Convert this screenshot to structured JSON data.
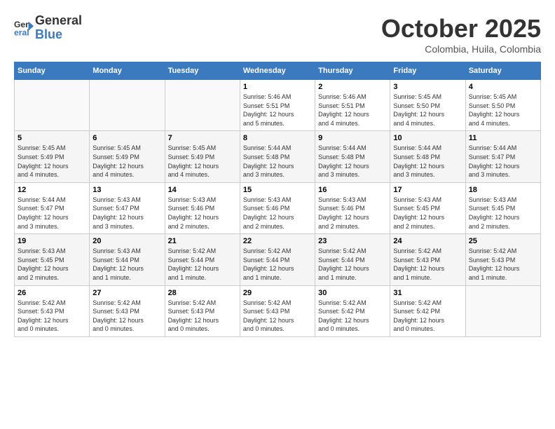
{
  "logo": {
    "line1": "General",
    "line2": "Blue"
  },
  "title": "October 2025",
  "subtitle": "Colombia, Huila, Colombia",
  "days_header": [
    "Sunday",
    "Monday",
    "Tuesday",
    "Wednesday",
    "Thursday",
    "Friday",
    "Saturday"
  ],
  "weeks": [
    [
      {
        "day": "",
        "info": ""
      },
      {
        "day": "",
        "info": ""
      },
      {
        "day": "",
        "info": ""
      },
      {
        "day": "1",
        "info": "Sunrise: 5:46 AM\nSunset: 5:51 PM\nDaylight: 12 hours\nand 5 minutes."
      },
      {
        "day": "2",
        "info": "Sunrise: 5:46 AM\nSunset: 5:51 PM\nDaylight: 12 hours\nand 4 minutes."
      },
      {
        "day": "3",
        "info": "Sunrise: 5:45 AM\nSunset: 5:50 PM\nDaylight: 12 hours\nand 4 minutes."
      },
      {
        "day": "4",
        "info": "Sunrise: 5:45 AM\nSunset: 5:50 PM\nDaylight: 12 hours\nand 4 minutes."
      }
    ],
    [
      {
        "day": "5",
        "info": "Sunrise: 5:45 AM\nSunset: 5:49 PM\nDaylight: 12 hours\nand 4 minutes."
      },
      {
        "day": "6",
        "info": "Sunrise: 5:45 AM\nSunset: 5:49 PM\nDaylight: 12 hours\nand 4 minutes."
      },
      {
        "day": "7",
        "info": "Sunrise: 5:45 AM\nSunset: 5:49 PM\nDaylight: 12 hours\nand 4 minutes."
      },
      {
        "day": "8",
        "info": "Sunrise: 5:44 AM\nSunset: 5:48 PM\nDaylight: 12 hours\nand 3 minutes."
      },
      {
        "day": "9",
        "info": "Sunrise: 5:44 AM\nSunset: 5:48 PM\nDaylight: 12 hours\nand 3 minutes."
      },
      {
        "day": "10",
        "info": "Sunrise: 5:44 AM\nSunset: 5:48 PM\nDaylight: 12 hours\nand 3 minutes."
      },
      {
        "day": "11",
        "info": "Sunrise: 5:44 AM\nSunset: 5:47 PM\nDaylight: 12 hours\nand 3 minutes."
      }
    ],
    [
      {
        "day": "12",
        "info": "Sunrise: 5:44 AM\nSunset: 5:47 PM\nDaylight: 12 hours\nand 3 minutes."
      },
      {
        "day": "13",
        "info": "Sunrise: 5:43 AM\nSunset: 5:47 PM\nDaylight: 12 hours\nand 3 minutes."
      },
      {
        "day": "14",
        "info": "Sunrise: 5:43 AM\nSunset: 5:46 PM\nDaylight: 12 hours\nand 2 minutes."
      },
      {
        "day": "15",
        "info": "Sunrise: 5:43 AM\nSunset: 5:46 PM\nDaylight: 12 hours\nand 2 minutes."
      },
      {
        "day": "16",
        "info": "Sunrise: 5:43 AM\nSunset: 5:46 PM\nDaylight: 12 hours\nand 2 minutes."
      },
      {
        "day": "17",
        "info": "Sunrise: 5:43 AM\nSunset: 5:45 PM\nDaylight: 12 hours\nand 2 minutes."
      },
      {
        "day": "18",
        "info": "Sunrise: 5:43 AM\nSunset: 5:45 PM\nDaylight: 12 hours\nand 2 minutes."
      }
    ],
    [
      {
        "day": "19",
        "info": "Sunrise: 5:43 AM\nSunset: 5:45 PM\nDaylight: 12 hours\nand 2 minutes."
      },
      {
        "day": "20",
        "info": "Sunrise: 5:43 AM\nSunset: 5:44 PM\nDaylight: 12 hours\nand 1 minute."
      },
      {
        "day": "21",
        "info": "Sunrise: 5:42 AM\nSunset: 5:44 PM\nDaylight: 12 hours\nand 1 minute."
      },
      {
        "day": "22",
        "info": "Sunrise: 5:42 AM\nSunset: 5:44 PM\nDaylight: 12 hours\nand 1 minute."
      },
      {
        "day": "23",
        "info": "Sunrise: 5:42 AM\nSunset: 5:44 PM\nDaylight: 12 hours\nand 1 minute."
      },
      {
        "day": "24",
        "info": "Sunrise: 5:42 AM\nSunset: 5:43 PM\nDaylight: 12 hours\nand 1 minute."
      },
      {
        "day": "25",
        "info": "Sunrise: 5:42 AM\nSunset: 5:43 PM\nDaylight: 12 hours\nand 1 minute."
      }
    ],
    [
      {
        "day": "26",
        "info": "Sunrise: 5:42 AM\nSunset: 5:43 PM\nDaylight: 12 hours\nand 0 minutes."
      },
      {
        "day": "27",
        "info": "Sunrise: 5:42 AM\nSunset: 5:43 PM\nDaylight: 12 hours\nand 0 minutes."
      },
      {
        "day": "28",
        "info": "Sunrise: 5:42 AM\nSunset: 5:43 PM\nDaylight: 12 hours\nand 0 minutes."
      },
      {
        "day": "29",
        "info": "Sunrise: 5:42 AM\nSunset: 5:43 PM\nDaylight: 12 hours\nand 0 minutes."
      },
      {
        "day": "30",
        "info": "Sunrise: 5:42 AM\nSunset: 5:42 PM\nDaylight: 12 hours\nand 0 minutes."
      },
      {
        "day": "31",
        "info": "Sunrise: 5:42 AM\nSunset: 5:42 PM\nDaylight: 12 hours\nand 0 minutes."
      },
      {
        "day": "",
        "info": ""
      }
    ]
  ]
}
